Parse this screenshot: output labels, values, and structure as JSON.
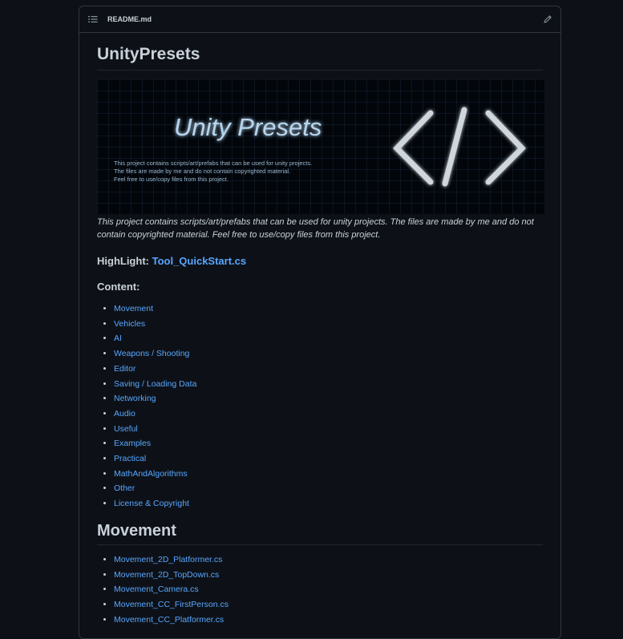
{
  "file": {
    "name": "README.md"
  },
  "icons": {
    "list": "list-icon",
    "edit": "pencil-icon"
  },
  "title": "UnityPresets",
  "banner": {
    "heading": "Unity Presets",
    "lines": [
      "This project contains scripts/art/prefabs that can be used for unity projects.",
      "The files are made by me and do not contain copyrighted material.",
      "Feel free to use/copy files from this project."
    ],
    "glyph": "</>"
  },
  "intro": "This project contains scripts/art/prefabs that can be used for unity projects. The files are made by me and do not contain copyrighted material. Feel free to use/copy files from this project.",
  "highlight": {
    "label": "HighLight:",
    "link": "Tool_QuickStart.cs"
  },
  "content_heading": "Content:",
  "content_items": [
    "Movement",
    "Vehicles",
    "AI",
    "Weapons / Shooting",
    "Editor",
    "Saving / Loading Data",
    "Networking",
    "Audio",
    "Useful",
    "Examples",
    "Practical",
    "MathAndAlgorithms",
    "Other",
    "License & Copyright"
  ],
  "movement_heading": "Movement",
  "movement_items": [
    "Movement_2D_Platformer.cs",
    "Movement_2D_TopDown.cs",
    "Movement_Camera.cs",
    "Movement_CC_FirstPerson.cs",
    "Movement_CC_Platformer.cs"
  ],
  "colors": {
    "background": "#0d1117",
    "link": "#58a6ff",
    "border": "#30363d",
    "text": "#c9d1d9",
    "glow": "#1fa8ff"
  }
}
